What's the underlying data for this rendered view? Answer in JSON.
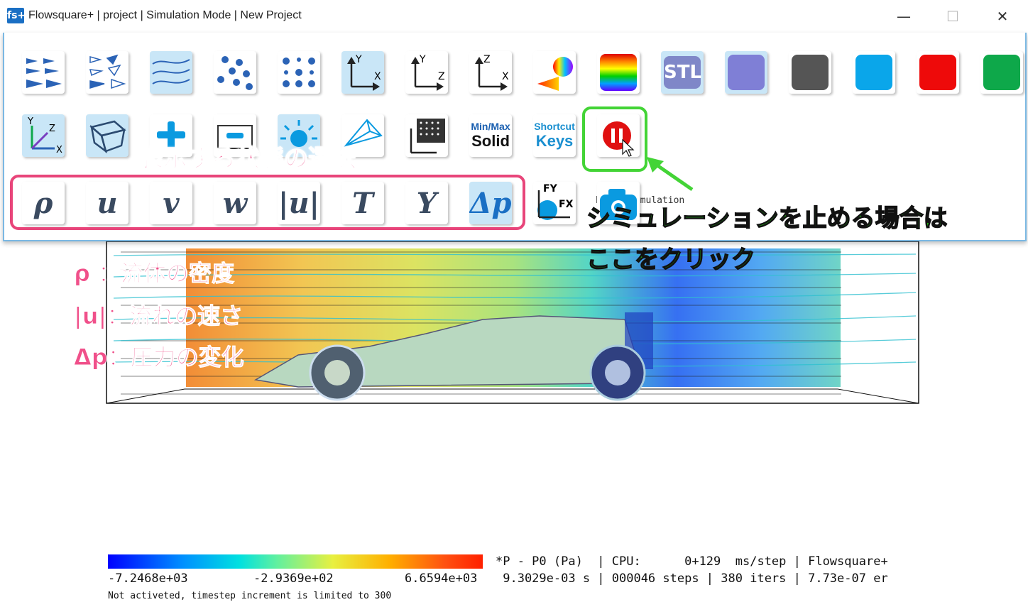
{
  "window": {
    "app_icon": "fs+",
    "title": "Flowsquare+ | project | Simulation Mode | New Project",
    "minimize": "—",
    "maximize": "☐",
    "close": "✕"
  },
  "toolbar": {
    "row1_icons": [
      "vector-arrows-icon",
      "vector-outline-arrows-icon",
      "streamline-icon",
      "particles-random-icon",
      "particles-grid-icon",
      "view-xy-icon",
      "view-yz-icon",
      "view-zx-icon",
      "colormap-icon",
      "color-gradient-icon",
      "stl-icon",
      "color-purple-icon",
      "color-gray-icon",
      "color-cyan-icon",
      "color-red-icon",
      "color-green-icon"
    ],
    "stl_label": "STL",
    "axis_labels": {
      "y": "Y",
      "x": "X",
      "z": "Z"
    },
    "minmax_line1": "Min/Max",
    "minmax_line2": "Solid",
    "shortcut_line1": "Shortcut",
    "shortcut_line2": "Keys",
    "pause_tooltip": "Pause simulation",
    "fy_label": "FY",
    "fx_label": "FX",
    "variables": [
      {
        "symbol": "ρ",
        "active": false
      },
      {
        "symbol": "u",
        "active": false
      },
      {
        "symbol": "v",
        "active": false
      },
      {
        "symbol": "w",
        "active": false
      },
      {
        "symbol": "|u|",
        "active": false
      },
      {
        "symbol": "T",
        "active": false
      },
      {
        "symbol": "Y",
        "active": false
      },
      {
        "symbol": "Δp",
        "active": true
      }
    ],
    "active_highlight_color": "#c9e6f7"
  },
  "annotations": {
    "select_state": "表示する状態の選択",
    "stop_sim_line1": "シミュレーションを止める場合は",
    "stop_sim_line2": "ここをクリック",
    "rho_desc": "ρ ：流体の密度",
    "u_desc": "|u|：流れの速さ",
    "dp_desc": "Δp：圧力の変化",
    "pink_color": "#e8457a",
    "green_color": "#43d436"
  },
  "colorbar": {
    "min": "-7.2468e+03",
    "mid": "-2.9369e+02",
    "max": "6.6594e+03"
  },
  "readout": {
    "line1": "*P - P0 (Pa)  | CPU:      0+129  ms/step | Flowsquare+",
    "line2": " 9.3029e-03 s | 000046 steps | 380 iters | 7.73e-07 er"
  },
  "status": "Not activeted, timestep increment is limited to 300"
}
